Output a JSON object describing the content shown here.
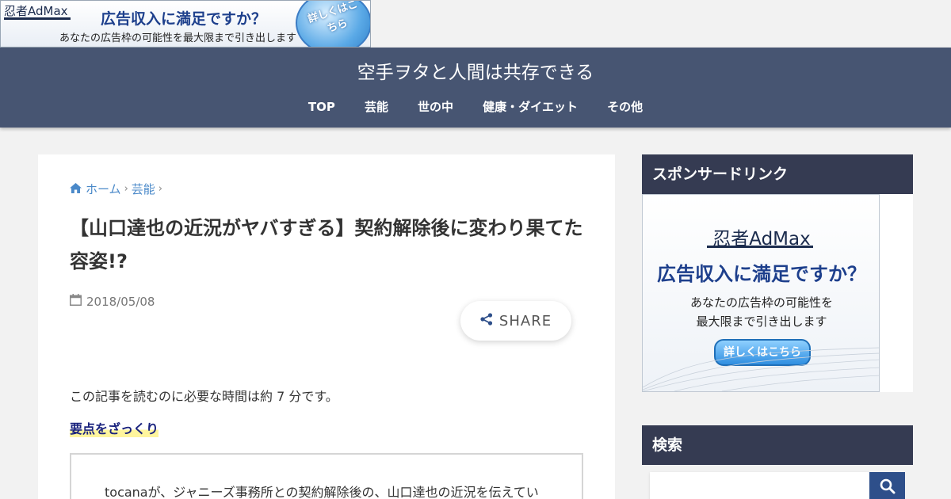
{
  "top_ad": {
    "logo": "忍者AdMax",
    "headline": "広告収入に満足ですか？",
    "subline": "あなたの広告枠の可能性を最大限まで引き出します",
    "cta": "詳しくはこちら"
  },
  "header": {
    "site_title": "空手ヲタと人間は共存できる",
    "nav": [
      "TOP",
      "芸能",
      "世の中",
      "健康・ダイエット",
      "その他"
    ]
  },
  "article": {
    "breadcrumb": [
      "ホーム",
      "芸能"
    ],
    "title": "【山口達也の近況がヤバすぎる】契約解除後に変わり果てた容姿!?",
    "date": "2018/05/08",
    "share_label": "SHARE",
    "intro": "この記事を読むのに必要な時間は約 7 分です。",
    "summary_heading": "要点をざっくり",
    "summary_items": [
      "tocanaが、ジャニーズ事務所との契約解除後の、山口達也の近況を伝えてい"
    ]
  },
  "sidebar": {
    "sponsor_heading": "スポンサードリンク",
    "ad": {
      "logo": "忍者AdMax",
      "headline": "広告収入に満足ですか？",
      "subline_1": "あなたの広告枠の可能性を",
      "subline_2": "最大限まで引き出します",
      "cta": "詳しくはこちら"
    },
    "search_heading": "検索",
    "search_placeholder": ""
  },
  "colors": {
    "header_bg": "#475572",
    "sidebar_heading_bg": "#353b52",
    "link": "#4a89c9",
    "search_button": "#2e4f8a"
  },
  "icons": {
    "breadcrumb_home": "home-icon",
    "date": "calendar-icon",
    "share": "share-icon",
    "search": "search-icon"
  }
}
